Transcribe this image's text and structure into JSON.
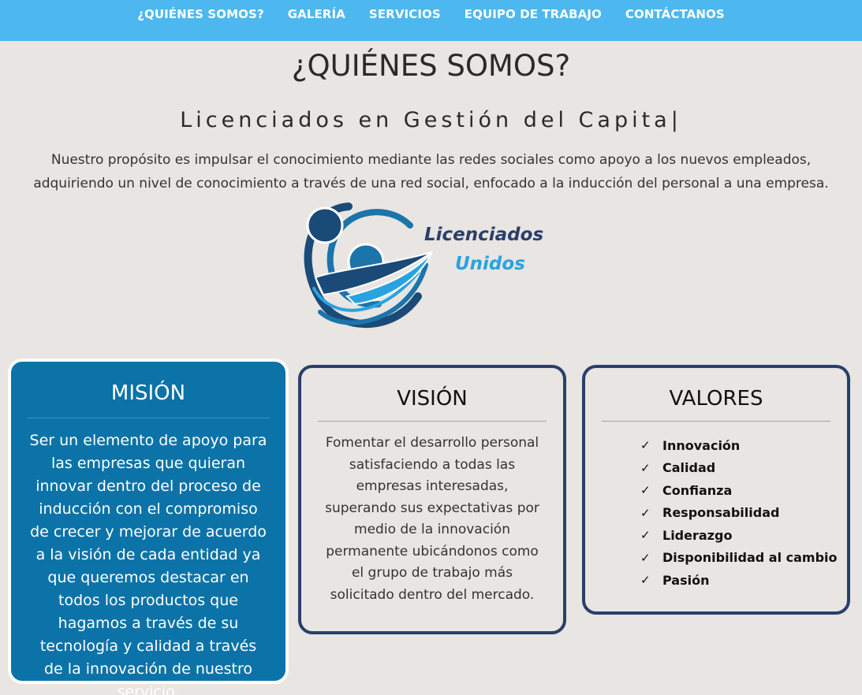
{
  "nav": {
    "items": [
      {
        "label": "¿QUIÉNES SOMOS?"
      },
      {
        "label": "GALERÍA"
      },
      {
        "label": "SERVICIOS"
      },
      {
        "label": "EQUIPO DE TRABAJO"
      },
      {
        "label": "CONTÁCTANOS"
      }
    ]
  },
  "header": {
    "title": "¿QUIÉNES SOMOS?",
    "subtitle": "Licenciados en Gestión del Capita|",
    "intro": "Nuestro propósito es impulsar el conocimiento mediante las redes sociales como apoyo a los nuevos empleados, adquiriendo un nivel de conocimiento a través de una red social, enfocado a la inducción del personal a una empresa."
  },
  "logo": {
    "line1": "Licenciados",
    "line2": "Unidos",
    "colors": {
      "dark": "#1a4a78",
      "mid": "#1b74aa",
      "light": "#29a3e0"
    }
  },
  "mision": {
    "title": "MISIÓN",
    "text": "Ser un elemento de apoyo para las empresas que quieran innovar dentro del proceso de inducción con el compromiso de crecer y mejorar de acuerdo a la visión de cada entidad ya que queremos destacar en todos los productos que hagamos a través de su tecnología y calidad a través de la innovación de nuestro servicio."
  },
  "vision": {
    "title": "VISIÓN",
    "text": "Fomentar el desarrollo personal satisfaciendo a todas las empresas interesadas, superando sus expectativas por medio de la innovación permanente ubicándonos como el grupo de trabajo más solicitado dentro del mercado."
  },
  "valores": {
    "title": "VALORES",
    "check": "✓",
    "items": [
      {
        "label": "Innovación"
      },
      {
        "label": "Calidad"
      },
      {
        "label": "Confianza"
      },
      {
        "label": "Responsabilidad"
      },
      {
        "label": "Liderazgo"
      },
      {
        "label": "Disponibilidad al cambio"
      },
      {
        "label": "Pasión"
      }
    ]
  },
  "colors": {
    "nav_bg": "#4db8ef",
    "page_bg": "#e8e5e2",
    "mision_bg": "#0b73a8",
    "card_border": "#293f6b"
  }
}
